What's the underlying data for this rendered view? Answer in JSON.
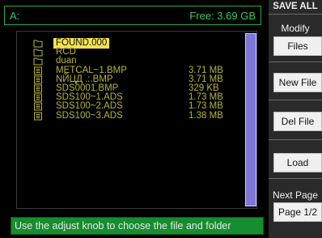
{
  "path_bar": {
    "drive": "A:",
    "free": "Free: 3.69 GB"
  },
  "files": [
    {
      "type": "folder",
      "name": "FOUND.000",
      "size": "",
      "selected": true
    },
    {
      "type": "folder",
      "name": "RCD",
      "size": "",
      "selected": false
    },
    {
      "type": "folder",
      "name": "duan",
      "size": "",
      "selected": false
    },
    {
      "type": "file",
      "name": "METCAL~1.BMP",
      "size": "3.71 MB",
      "selected": false
    },
    {
      "type": "file",
      "name": "NЙЦД .:.BMP",
      "size": "3.71 MB",
      "selected": false
    },
    {
      "type": "file",
      "name": "SDS0001.BMP",
      "size": "329 KB",
      "selected": false
    },
    {
      "type": "file",
      "name": "SDS100~1.ADS",
      "size": "1.73 MB",
      "selected": false
    },
    {
      "type": "file",
      "name": "SDS100~2.ADS",
      "size": "1.73 MB",
      "selected": false
    },
    {
      "type": "file",
      "name": "SDS100~3.ADS",
      "size": "1.38 MB",
      "selected": false
    }
  ],
  "hint": "Use the adjust knob to choose the file and folder",
  "menu": {
    "title": "SAVE ALL",
    "modify_label": "Modify",
    "files_button": "Files",
    "new_file_button": "New File",
    "del_file_button": "Del File",
    "load_button": "Load",
    "next_page_label": "Next Page",
    "page_button": "Page 1/2"
  },
  "colors": {
    "path_text": "#36c95a",
    "file_text": "#b7b43c",
    "selection": "#f3e24e",
    "hint_bg": "#168d2f",
    "scrollbar": "#7f75d9"
  }
}
